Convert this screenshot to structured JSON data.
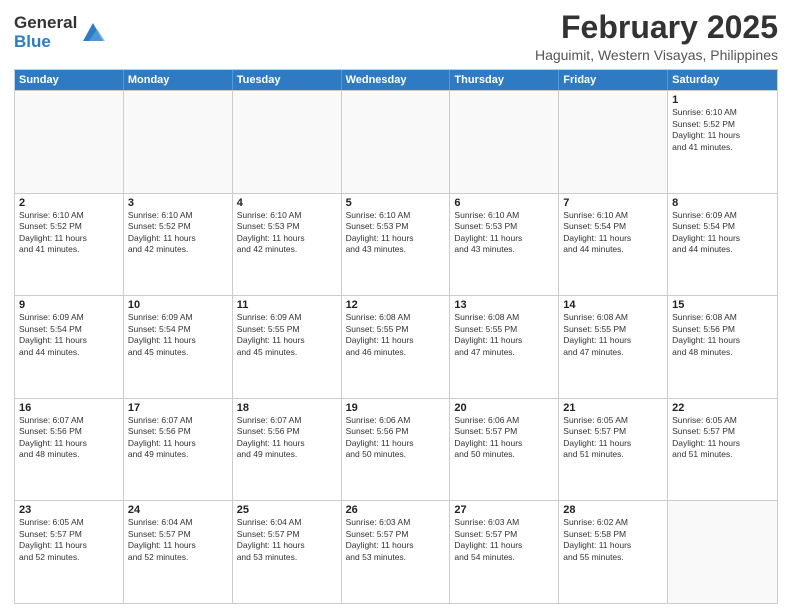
{
  "logo": {
    "general": "General",
    "blue": "Blue"
  },
  "title": "February 2025",
  "subtitle": "Haguimit, Western Visayas, Philippines",
  "weekdays": [
    "Sunday",
    "Monday",
    "Tuesday",
    "Wednesday",
    "Thursday",
    "Friday",
    "Saturday"
  ],
  "rows": [
    [
      {
        "day": "",
        "info": ""
      },
      {
        "day": "",
        "info": ""
      },
      {
        "day": "",
        "info": ""
      },
      {
        "day": "",
        "info": ""
      },
      {
        "day": "",
        "info": ""
      },
      {
        "day": "",
        "info": ""
      },
      {
        "day": "1",
        "info": "Sunrise: 6:10 AM\nSunset: 5:52 PM\nDaylight: 11 hours\nand 41 minutes."
      }
    ],
    [
      {
        "day": "2",
        "info": "Sunrise: 6:10 AM\nSunset: 5:52 PM\nDaylight: 11 hours\nand 41 minutes."
      },
      {
        "day": "3",
        "info": "Sunrise: 6:10 AM\nSunset: 5:52 PM\nDaylight: 11 hours\nand 42 minutes."
      },
      {
        "day": "4",
        "info": "Sunrise: 6:10 AM\nSunset: 5:53 PM\nDaylight: 11 hours\nand 42 minutes."
      },
      {
        "day": "5",
        "info": "Sunrise: 6:10 AM\nSunset: 5:53 PM\nDaylight: 11 hours\nand 43 minutes."
      },
      {
        "day": "6",
        "info": "Sunrise: 6:10 AM\nSunset: 5:53 PM\nDaylight: 11 hours\nand 43 minutes."
      },
      {
        "day": "7",
        "info": "Sunrise: 6:10 AM\nSunset: 5:54 PM\nDaylight: 11 hours\nand 44 minutes."
      },
      {
        "day": "8",
        "info": "Sunrise: 6:09 AM\nSunset: 5:54 PM\nDaylight: 11 hours\nand 44 minutes."
      }
    ],
    [
      {
        "day": "9",
        "info": "Sunrise: 6:09 AM\nSunset: 5:54 PM\nDaylight: 11 hours\nand 44 minutes."
      },
      {
        "day": "10",
        "info": "Sunrise: 6:09 AM\nSunset: 5:54 PM\nDaylight: 11 hours\nand 45 minutes."
      },
      {
        "day": "11",
        "info": "Sunrise: 6:09 AM\nSunset: 5:55 PM\nDaylight: 11 hours\nand 45 minutes."
      },
      {
        "day": "12",
        "info": "Sunrise: 6:08 AM\nSunset: 5:55 PM\nDaylight: 11 hours\nand 46 minutes."
      },
      {
        "day": "13",
        "info": "Sunrise: 6:08 AM\nSunset: 5:55 PM\nDaylight: 11 hours\nand 47 minutes."
      },
      {
        "day": "14",
        "info": "Sunrise: 6:08 AM\nSunset: 5:55 PM\nDaylight: 11 hours\nand 47 minutes."
      },
      {
        "day": "15",
        "info": "Sunrise: 6:08 AM\nSunset: 5:56 PM\nDaylight: 11 hours\nand 48 minutes."
      }
    ],
    [
      {
        "day": "16",
        "info": "Sunrise: 6:07 AM\nSunset: 5:56 PM\nDaylight: 11 hours\nand 48 minutes."
      },
      {
        "day": "17",
        "info": "Sunrise: 6:07 AM\nSunset: 5:56 PM\nDaylight: 11 hours\nand 49 minutes."
      },
      {
        "day": "18",
        "info": "Sunrise: 6:07 AM\nSunset: 5:56 PM\nDaylight: 11 hours\nand 49 minutes."
      },
      {
        "day": "19",
        "info": "Sunrise: 6:06 AM\nSunset: 5:56 PM\nDaylight: 11 hours\nand 50 minutes."
      },
      {
        "day": "20",
        "info": "Sunrise: 6:06 AM\nSunset: 5:57 PM\nDaylight: 11 hours\nand 50 minutes."
      },
      {
        "day": "21",
        "info": "Sunrise: 6:05 AM\nSunset: 5:57 PM\nDaylight: 11 hours\nand 51 minutes."
      },
      {
        "day": "22",
        "info": "Sunrise: 6:05 AM\nSunset: 5:57 PM\nDaylight: 11 hours\nand 51 minutes."
      }
    ],
    [
      {
        "day": "23",
        "info": "Sunrise: 6:05 AM\nSunset: 5:57 PM\nDaylight: 11 hours\nand 52 minutes."
      },
      {
        "day": "24",
        "info": "Sunrise: 6:04 AM\nSunset: 5:57 PM\nDaylight: 11 hours\nand 52 minutes."
      },
      {
        "day": "25",
        "info": "Sunrise: 6:04 AM\nSunset: 5:57 PM\nDaylight: 11 hours\nand 53 minutes."
      },
      {
        "day": "26",
        "info": "Sunrise: 6:03 AM\nSunset: 5:57 PM\nDaylight: 11 hours\nand 53 minutes."
      },
      {
        "day": "27",
        "info": "Sunrise: 6:03 AM\nSunset: 5:57 PM\nDaylight: 11 hours\nand 54 minutes."
      },
      {
        "day": "28",
        "info": "Sunrise: 6:02 AM\nSunset: 5:58 PM\nDaylight: 11 hours\nand 55 minutes."
      },
      {
        "day": "",
        "info": ""
      }
    ]
  ]
}
